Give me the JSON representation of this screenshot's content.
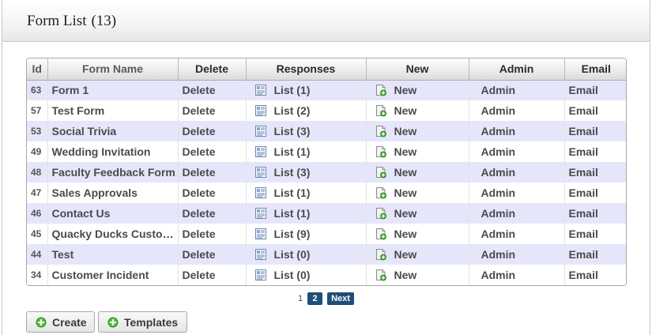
{
  "panel": {
    "title": "Form List",
    "count": "(13)"
  },
  "table": {
    "headers": {
      "id": "Id",
      "name": "Form Name",
      "delete": "Delete",
      "responses": "Responses",
      "new": "New",
      "admin": "Admin",
      "email": "Email"
    },
    "rows": [
      {
        "id": "63",
        "name": "Form 1",
        "delete": "Delete",
        "responses": "List (1)",
        "new": "New",
        "admin": "Admin",
        "email": "Email"
      },
      {
        "id": "57",
        "name": "Test Form",
        "delete": "Delete",
        "responses": "List (2)",
        "new": "New",
        "admin": "Admin",
        "email": "Email"
      },
      {
        "id": "53",
        "name": "Social Trivia",
        "delete": "Delete",
        "responses": "List (3)",
        "new": "New",
        "admin": "Admin",
        "email": "Email"
      },
      {
        "id": "49",
        "name": "Wedding Invitation",
        "delete": "Delete",
        "responses": "List (1)",
        "new": "New",
        "admin": "Admin",
        "email": "Email"
      },
      {
        "id": "48",
        "name": "Faculty Feedback Form",
        "delete": "Delete",
        "responses": "List (3)",
        "new": "New",
        "admin": "Admin",
        "email": "Email"
      },
      {
        "id": "47",
        "name": "Sales Approvals",
        "delete": "Delete",
        "responses": "List (1)",
        "new": "New",
        "admin": "Admin",
        "email": "Email"
      },
      {
        "id": "46",
        "name": "Contact Us",
        "delete": "Delete",
        "responses": "List (1)",
        "new": "New",
        "admin": "Admin",
        "email": "Email"
      },
      {
        "id": "45",
        "name": "Quacky Ducks Custom…",
        "delete": "Delete",
        "responses": "List (9)",
        "new": "New",
        "admin": "Admin",
        "email": "Email"
      },
      {
        "id": "44",
        "name": "Test",
        "delete": "Delete",
        "responses": "List (0)",
        "new": "New",
        "admin": "Admin",
        "email": "Email"
      },
      {
        "id": "34",
        "name": "Customer Incident",
        "delete": "Delete",
        "responses": "List (0)",
        "new": "New",
        "admin": "Admin",
        "email": "Email"
      }
    ]
  },
  "pagination": {
    "page1": "1",
    "page2": "2",
    "next": "Next",
    "current_page": 2
  },
  "buttons": {
    "create": "Create",
    "templates": "Templates"
  },
  "icons": {
    "responses": "list-document-icon",
    "new": "new-document-icon",
    "buttons": "plus-circle-icon"
  },
  "colors": {
    "stripe": "#e6e6fb",
    "pager_active": "#1f4e79",
    "plus_green": "#3a9a2a"
  }
}
